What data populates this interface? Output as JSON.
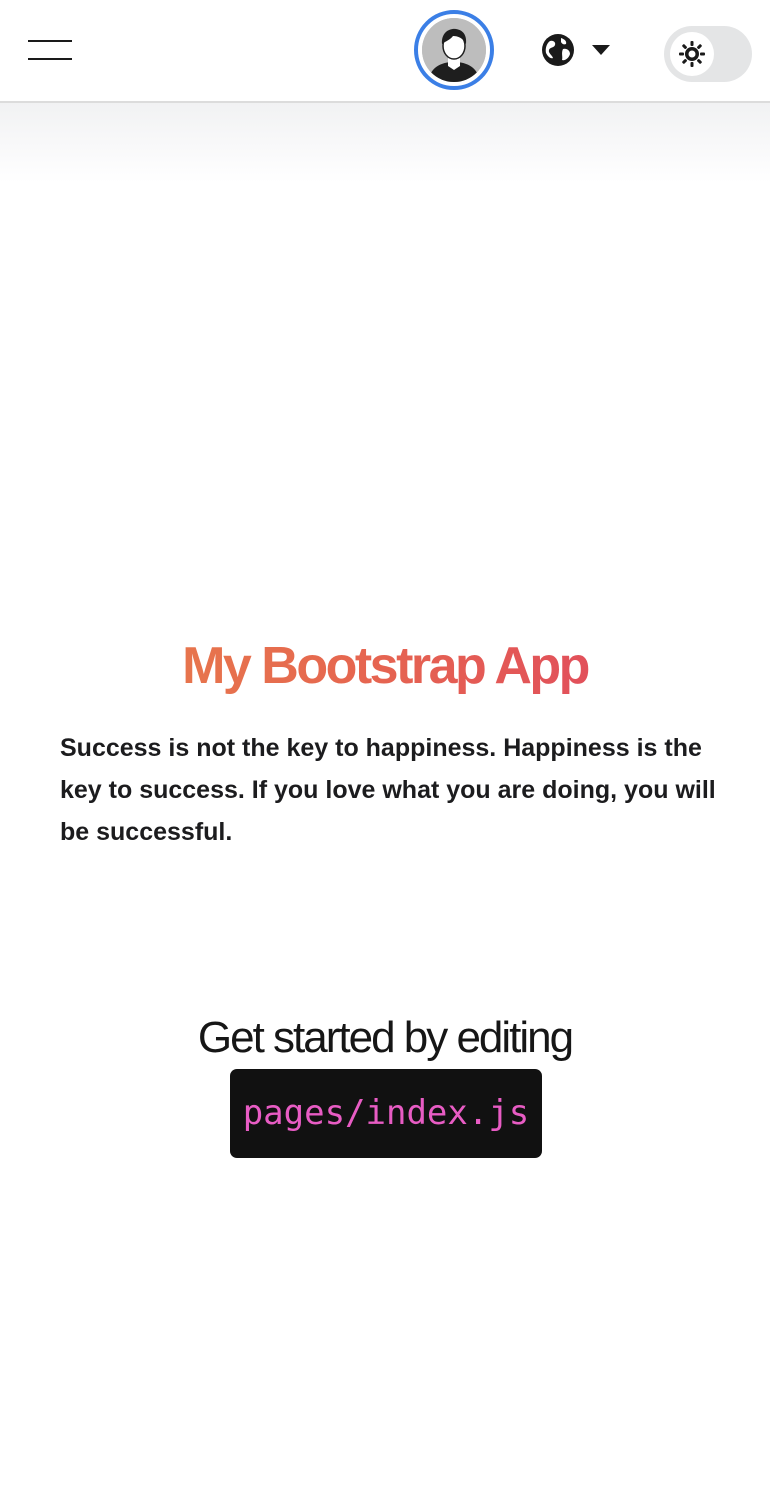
{
  "navbar": {
    "menu_icon": "hamburger-menu-icon",
    "avatar_icon": "user-avatar-icon",
    "language_icon": "globe-icon",
    "language_dropdown_icon": "caret-down-icon",
    "theme_icon": "sun-icon",
    "colors": {
      "avatar_ring": "#3b7fe6",
      "switch_track": "#e4e5e6"
    }
  },
  "hero": {
    "title": "My Bootstrap App",
    "quote": "Success is not the key to happiness. Happiness is the key to success. If you love what you are doing, you will be successful.",
    "title_gradient": [
      "#e8844a",
      "#de3f63"
    ]
  },
  "get_started": {
    "text": "Get started by editing",
    "code": "pages/index.js",
    "code_color": "#e85cc4",
    "code_bg": "#111111"
  }
}
